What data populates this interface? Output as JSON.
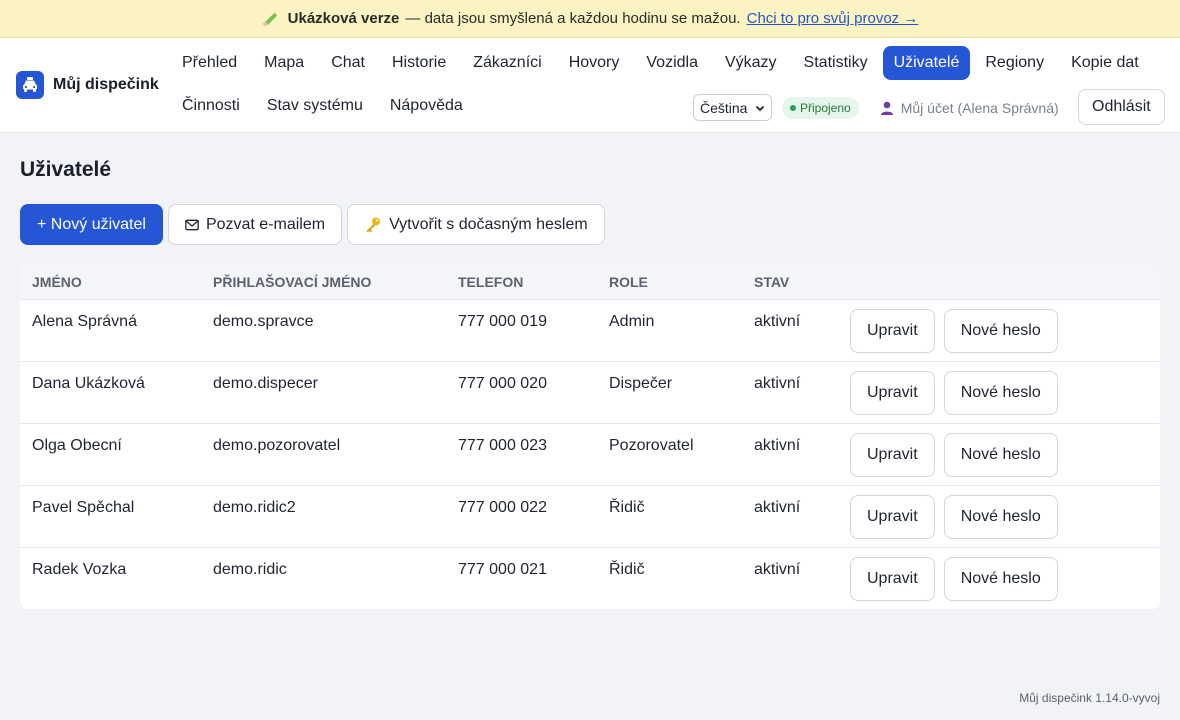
{
  "banner": {
    "title": "Ukázková verze",
    "text": "— data jsou smyšlená a každou hodinu se mažou.",
    "link": "Chci to pro svůj provoz →"
  },
  "brand": {
    "name": "Můj dispečink"
  },
  "nav": {
    "row1": [
      "Přehled",
      "Mapa",
      "Chat",
      "Historie",
      "Zákazníci",
      "Hovory",
      "Vozidla",
      "Výkazy",
      "Statistiky",
      "Uživatelé",
      "Regiony",
      "Kopie dat"
    ],
    "row2": [
      "Činnosti",
      "Stav systému",
      "Nápověda"
    ],
    "active": "Uživatelé"
  },
  "tools": {
    "language": "Čeština",
    "status": "Připojeno",
    "account": "Můj účet (Alena Správná)",
    "logout": "Odhlásit"
  },
  "page": {
    "title": "Uživatelé",
    "new_user": "+ Nový uživatel",
    "invite_email": "Pozvat e-mailem",
    "create_temp": "Vytvořit s dočasným heslem"
  },
  "table": {
    "headers": [
      "Jméno",
      "Přihlašovací jméno",
      "Telefon",
      "Role",
      "Stav"
    ],
    "rows": [
      {
        "name": "Alena Správná",
        "login": "demo.spravce",
        "phone": "777 000 019",
        "role": "Admin",
        "status": "aktivní"
      },
      {
        "name": "Dana Ukázková",
        "login": "demo.dispecer",
        "phone": "777 000 020",
        "role": "Dispečer",
        "status": "aktivní"
      },
      {
        "name": "Olga Obecní",
        "login": "demo.pozorovatel",
        "phone": "777 000 023",
        "role": "Pozorovatel",
        "status": "aktivní"
      },
      {
        "name": "Pavel Spěchal",
        "login": "demo.ridic2",
        "phone": "777 000 022",
        "role": "Řidič",
        "status": "aktivní"
      },
      {
        "name": "Radek Vozka",
        "login": "demo.ridic",
        "phone": "777 000 021",
        "role": "Řidič",
        "status": "aktivní"
      }
    ],
    "edit_label": "Upravit",
    "reset_label": "Nové heslo"
  },
  "footer": {
    "version": "Můj dispečink 1.14.0-vyvoj"
  },
  "colors": {
    "accent": "#2456d6",
    "banner_bg": "#fbf3c2",
    "status_ok": "#1f7a3a"
  }
}
